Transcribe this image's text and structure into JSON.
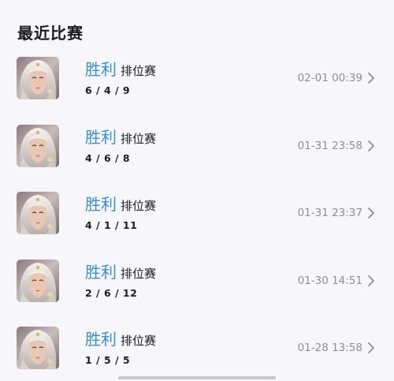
{
  "section_title": "最近比赛",
  "matches": [
    {
      "result": "胜利",
      "mode": "排位赛",
      "kda": "6 / 4 / 9",
      "time": "02-01 00:39",
      "avatar_icon": "hero-portrait-icon",
      "detail_icon": "chevron-right-icon"
    },
    {
      "result": "胜利",
      "mode": "排位赛",
      "kda": "4 / 6 / 8",
      "time": "01-31 23:58",
      "avatar_icon": "hero-portrait-icon",
      "detail_icon": "chevron-right-icon"
    },
    {
      "result": "胜利",
      "mode": "排位赛",
      "kda": "4 / 1 / 11",
      "time": "01-31 23:37",
      "avatar_icon": "hero-portrait-icon",
      "detail_icon": "chevron-right-icon"
    },
    {
      "result": "胜利",
      "mode": "排位赛",
      "kda": "2 / 6 / 12",
      "time": "01-30 14:51",
      "avatar_icon": "hero-portrait-icon",
      "detail_icon": "chevron-right-icon"
    },
    {
      "result": "胜利",
      "mode": "排位赛",
      "kda": "1 / 5 / 5",
      "time": "01-28 13:58",
      "avatar_icon": "hero-portrait-icon",
      "detail_icon": "chevron-right-icon"
    }
  ],
  "colors": {
    "background": "#f7f7fb",
    "win_text": "#3b8ecf",
    "primary_text": "#1c1c1e",
    "secondary_text": "#8e8e93"
  }
}
